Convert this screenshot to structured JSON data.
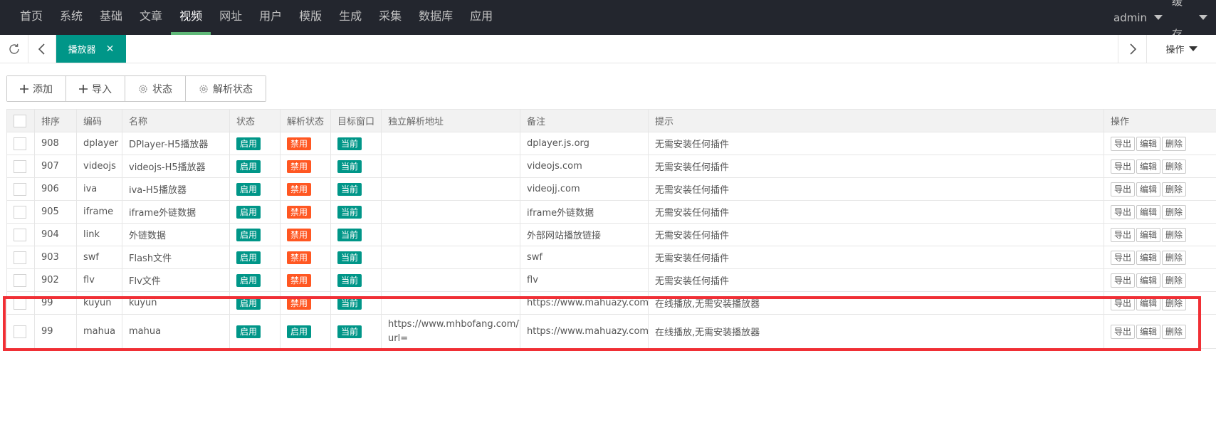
{
  "nav": {
    "items": [
      "首页",
      "系统",
      "基础",
      "文章",
      "视频",
      "网址",
      "用户",
      "模版",
      "生成",
      "采集",
      "数据库",
      "应用"
    ],
    "active_index": 4,
    "user": "admin",
    "cache": "缓存"
  },
  "tabs": {
    "active_label": "播放器",
    "ops_label": "操作"
  },
  "toolbar": {
    "add": "添加",
    "import": "导入",
    "status": "状态",
    "parse_status": "解析状态"
  },
  "table": {
    "headers": {
      "sort": "排序",
      "code": "编码",
      "name": "名称",
      "status": "状态",
      "parse_status": "解析状态",
      "target": "目标窗口",
      "parse_url": "独立解析地址",
      "remark": "备注",
      "tip": "提示",
      "ops": "操作"
    },
    "ops": {
      "export": "导出",
      "edit": "编辑",
      "delete": "删除"
    },
    "rows": [
      {
        "sort": "908",
        "code": "dplayer",
        "name": "DPlayer-H5播放器",
        "status": "启用",
        "parse": "禁用",
        "target": "当前",
        "url": "",
        "remark": "dplayer.js.org",
        "tip": "无需安装任何插件"
      },
      {
        "sort": "907",
        "code": "videojs",
        "name": "videojs-H5播放器",
        "status": "启用",
        "parse": "禁用",
        "target": "当前",
        "url": "",
        "remark": "videojs.com",
        "tip": "无需安装任何插件"
      },
      {
        "sort": "906",
        "code": "iva",
        "name": "iva-H5播放器",
        "status": "启用",
        "parse": "禁用",
        "target": "当前",
        "url": "",
        "remark": "videojj.com",
        "tip": "无需安装任何插件"
      },
      {
        "sort": "905",
        "code": "iframe",
        "name": "iframe外链数据",
        "status": "启用",
        "parse": "禁用",
        "target": "当前",
        "url": "",
        "remark": "iframe外链数据",
        "tip": "无需安装任何插件"
      },
      {
        "sort": "904",
        "code": "link",
        "name": "外链数据",
        "status": "启用",
        "parse": "禁用",
        "target": "当前",
        "url": "",
        "remark": "外部网站播放链接",
        "tip": "无需安装任何插件"
      },
      {
        "sort": "903",
        "code": "swf",
        "name": "Flash文件",
        "status": "启用",
        "parse": "禁用",
        "target": "当前",
        "url": "",
        "remark": "swf",
        "tip": "无需安装任何插件"
      },
      {
        "sort": "902",
        "code": "flv",
        "name": "Flv文件",
        "status": "启用",
        "parse": "禁用",
        "target": "当前",
        "url": "",
        "remark": "flv",
        "tip": "无需安装任何插件"
      },
      {
        "sort": "99",
        "code": "kuyun",
        "name": "kuyun",
        "status": "启用",
        "parse": "禁用",
        "target": "当前",
        "url": "",
        "remark": "https://www.mahuazy.com/",
        "tip": "在线播放,无需安装播放器"
      },
      {
        "sort": "99",
        "code": "mahua",
        "name": "mahua",
        "status": "启用",
        "parse": "启用",
        "target": "当前",
        "url": "https://www.mhbofang.com/?url=",
        "remark": "https://www.mahuazy.com/",
        "tip": "在线播放,无需安装播放器"
      }
    ]
  },
  "colors": {
    "nav_bg": "#23262e",
    "accent": "#009688",
    "nav_active_bar": "#5fb878",
    "badge_disabled": "#ff5722",
    "highlight": "#f02f35"
  }
}
